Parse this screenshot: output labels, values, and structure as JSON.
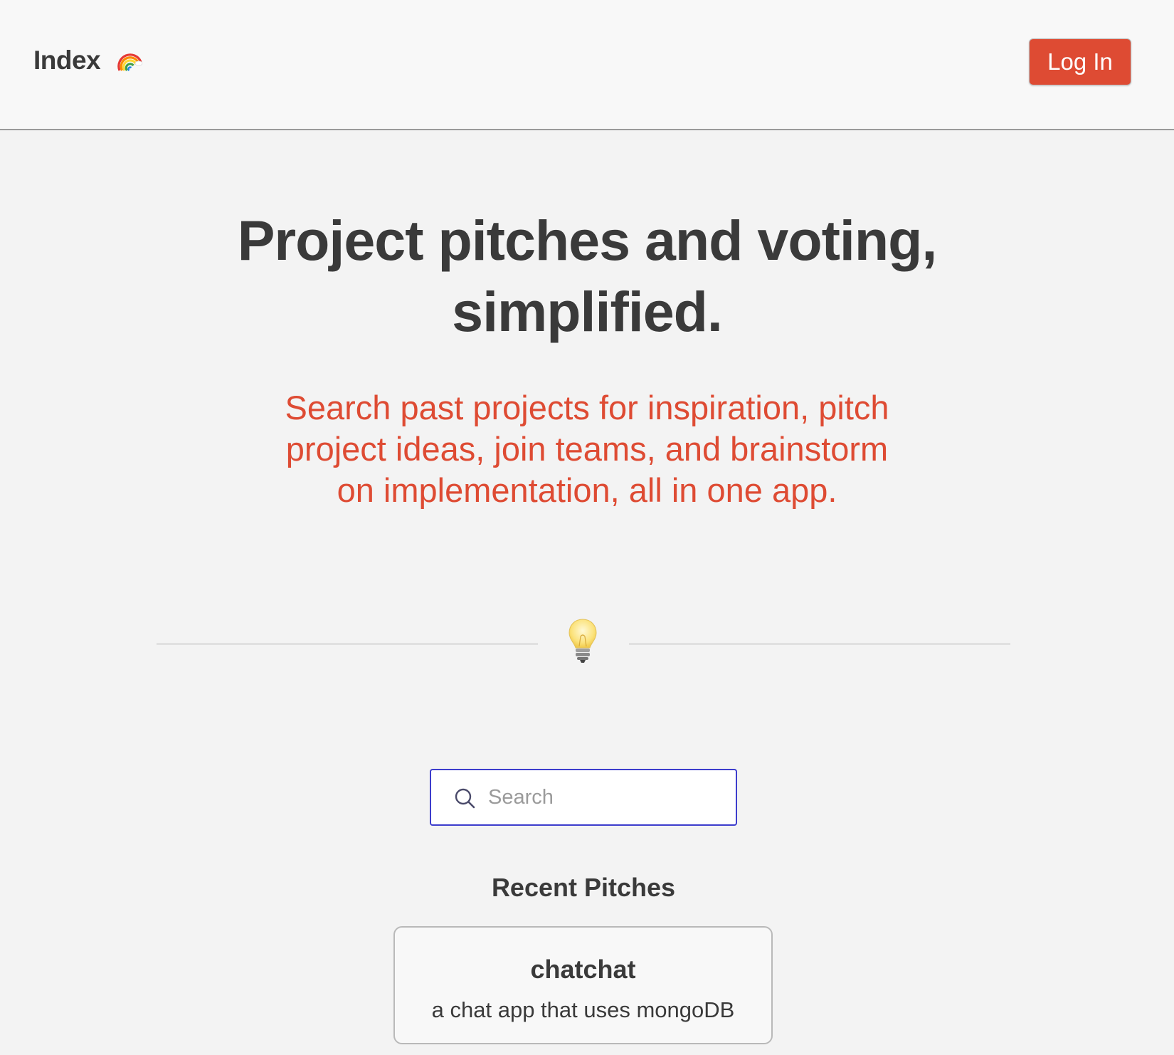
{
  "header": {
    "brand": "Index",
    "brand_icon": "rainbow-icon",
    "login_label": "Log In",
    "login_color": "#de4b33"
  },
  "hero": {
    "title": "Project pitches and voting, simplified.",
    "subtitle": "Search past projects for inspiration, pitch project ideas, join teams, and brainstorm on implementation, all in one app.",
    "subtitle_color": "#de4b33"
  },
  "divider": {
    "icon": "lightbulb-icon"
  },
  "search": {
    "placeholder": "Search",
    "value": "",
    "icon": "search-icon",
    "border_color": "#3d3dcc"
  },
  "recent": {
    "heading": "Recent Pitches",
    "pitches": [
      {
        "title": "chatchat",
        "description": "a chat app that uses mongoDB"
      }
    ]
  }
}
